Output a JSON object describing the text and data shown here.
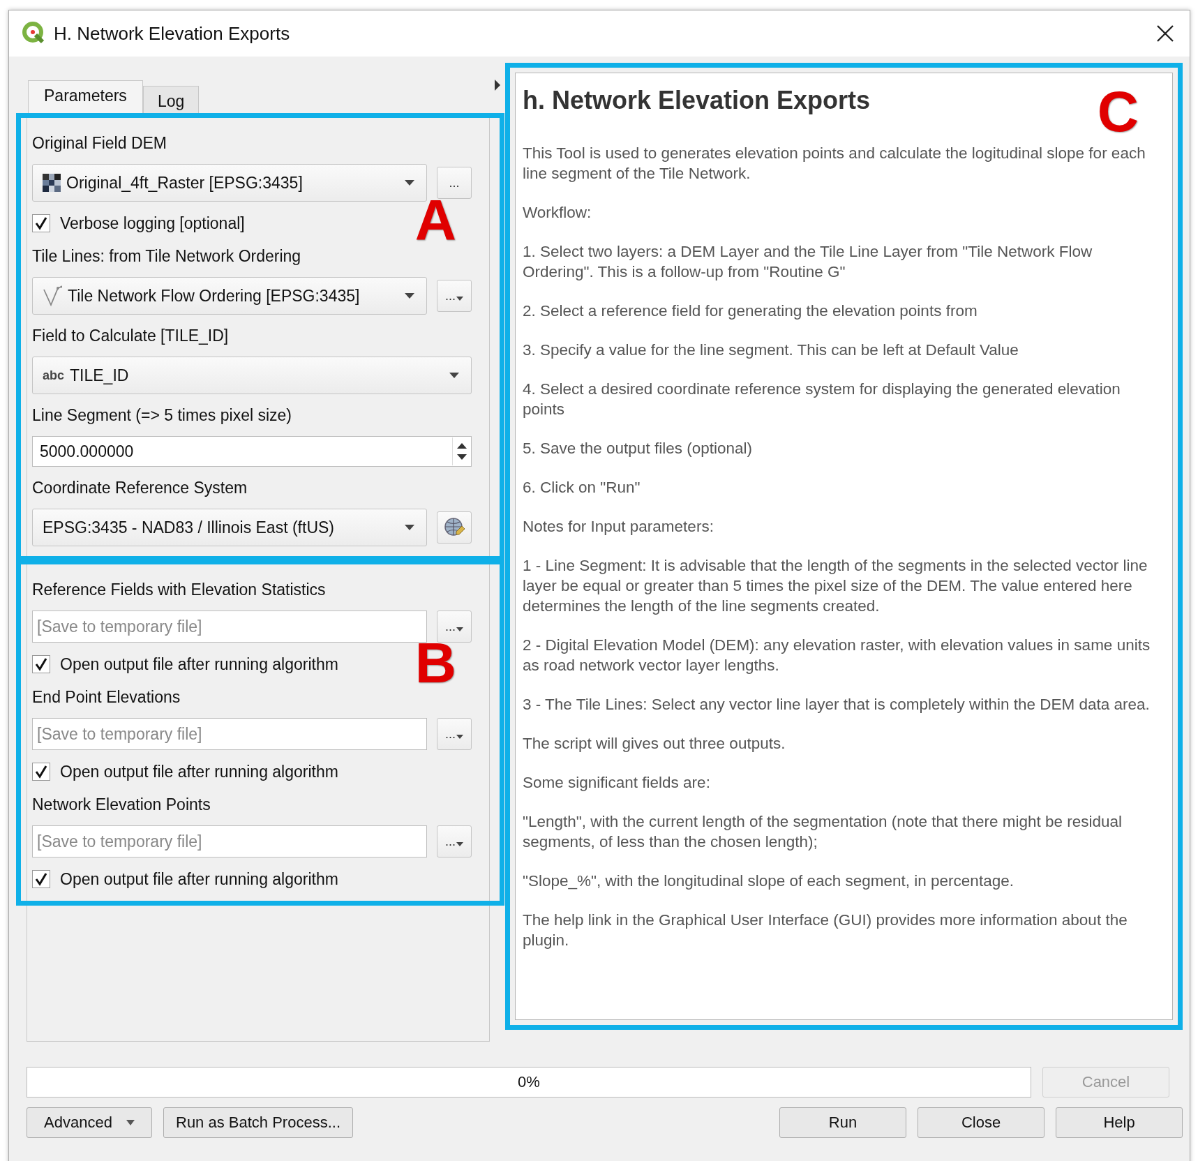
{
  "window": {
    "title": "H. Network Elevation Exports"
  },
  "tabs": [
    {
      "label": "Parameters",
      "selected": true
    },
    {
      "label": "Log",
      "selected": false
    }
  ],
  "sections": [
    {
      "mark": "A",
      "items": [
        {
          "kind": "label",
          "text": "Original Field DEM"
        },
        {
          "kind": "raster",
          "value": "Original_4ft_Raster [EPSG:3435]",
          "button": "..."
        },
        {
          "kind": "check",
          "label": "Verbose logging [optional]",
          "checked": true
        },
        {
          "kind": "label",
          "text": "Tile Lines: from Tile Network Ordering"
        },
        {
          "kind": "vector",
          "value": "Tile Network Flow Ordering [EPSG:3435]",
          "button": "..."
        },
        {
          "kind": "label",
          "text": "Field to Calculate [TILE_ID]"
        },
        {
          "kind": "field",
          "prefix": "abc",
          "value": "TILE_ID"
        },
        {
          "kind": "label",
          "text": "Line Segment (=> 5 times pixel size)"
        },
        {
          "kind": "spin",
          "value": "5000.000000"
        },
        {
          "kind": "label",
          "text": "Coordinate Reference System"
        },
        {
          "kind": "crs",
          "value": "EPSG:3435 - NAD83 / Illinois East (ftUS)"
        }
      ]
    },
    {
      "mark": "B",
      "items": [
        {
          "kind": "label",
          "text": "Reference Fields with Elevation Statistics"
        },
        {
          "kind": "file",
          "placeholder": "[Save to temporary file]",
          "button": "..."
        },
        {
          "kind": "check",
          "label": "Open output file after running algorithm",
          "checked": true
        },
        {
          "kind": "label",
          "text": "End Point Elevations"
        },
        {
          "kind": "file",
          "placeholder": "[Save to temporary file]",
          "button": "..."
        },
        {
          "kind": "check",
          "label": "Open output file after running algorithm",
          "checked": true
        },
        {
          "kind": "label",
          "text": "Network Elevation Points"
        },
        {
          "kind": "file",
          "placeholder": "[Save to temporary file]",
          "button": "..."
        },
        {
          "kind": "check",
          "label": "Open output file after running algorithm",
          "checked": true
        }
      ]
    }
  ],
  "help": {
    "mark": "C",
    "title": "h. Network Elevation Exports",
    "paragraphs": [
      "This Tool is used to generates elevation points and calculate the logitudinal slope for each line segment of the Tile Network.",
      "Workflow:",
      "1. Select two layers: a DEM Layer and the Tile Line Layer from \"Tile Network Flow Ordering\". This is a follow-up from \"Routine G\"",
      "2. Select a reference field for generating the elevation points from",
      "3. Specify a value for the line segment. This can be left at Default Value",
      "4. Select a desired coordinate reference system for displaying the generated elevation points",
      "5. Save the output files (optional)",
      "6. Click on \"Run\"",
      "Notes for Input parameters:",
      "1 - Line Segment: It is advisable that the length of the segments in the selected vector line layer be equal or greater than 5 times the pixel size of the DEM. The value entered here determines the length of the line segments created.",
      "2 - Digital Elevation Model (DEM): any elevation raster, with elevation values in same units as road network vector layer lengths.",
      "3 - The Tile Lines: Select any vector line layer that is completely within the DEM data area.",
      "The script will gives out three outputs.",
      "Some significant fields are:",
      "\"Length\", with the current length of the segmentation (note that there might be residual segments, of less than the chosen length);",
      "\"Slope_%\", with the longitudinal slope of each segment, in percentage.",
      "The help link in the Graphical User Interface (GUI) provides more information about the plugin."
    ]
  },
  "progress": {
    "level": 0,
    "reading": "0%"
  },
  "cancel": {
    "label": "Cancel",
    "disabled": true
  },
  "buttons": [
    {
      "label": "Advanced",
      "kind": "menu"
    },
    {
      "label": "Run as Batch Process...",
      "kind": "plain"
    },
    {
      "label": "Run",
      "kind": "plain"
    },
    {
      "label": "Close",
      "kind": "plain"
    },
    {
      "label": "Help",
      "kind": "plain"
    }
  ]
}
